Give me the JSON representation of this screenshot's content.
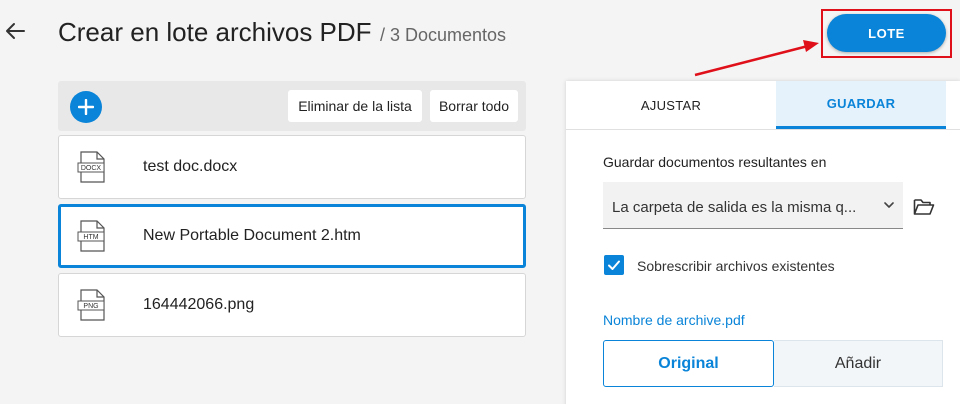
{
  "header": {
    "title": "Crear en lote archivos PDF",
    "subtitle": "/ 3 Documentos",
    "lote_button": "LOTE"
  },
  "file_panel": {
    "remove_label": "Eliminar de la lista",
    "clear_label": "Borrar todo",
    "files": [
      {
        "name": "test doc.docx",
        "type": "DOCX",
        "selected": false
      },
      {
        "name": "New Portable Document 2.htm",
        "type": "HTM",
        "selected": true
      },
      {
        "name": "164442066.png",
        "type": "PNG",
        "selected": false
      }
    ]
  },
  "settings": {
    "tabs": [
      {
        "label": "AJUSTAR",
        "active": false
      },
      {
        "label": "GUARDAR",
        "active": true
      }
    ],
    "save_label": "Guardar documentos resultantes en",
    "save_select_value": "La carpeta de salida es la misma q...",
    "overwrite_label": "Sobrescribir archivos existentes",
    "overwrite_checked": true,
    "filename_label": "Nombre de archive.pdf",
    "filename_options": [
      {
        "label": "Original",
        "active": true
      },
      {
        "label": "Añadir",
        "active": false
      }
    ]
  },
  "colors": {
    "accent": "#0a84d8",
    "annotation": "#e0101a"
  }
}
